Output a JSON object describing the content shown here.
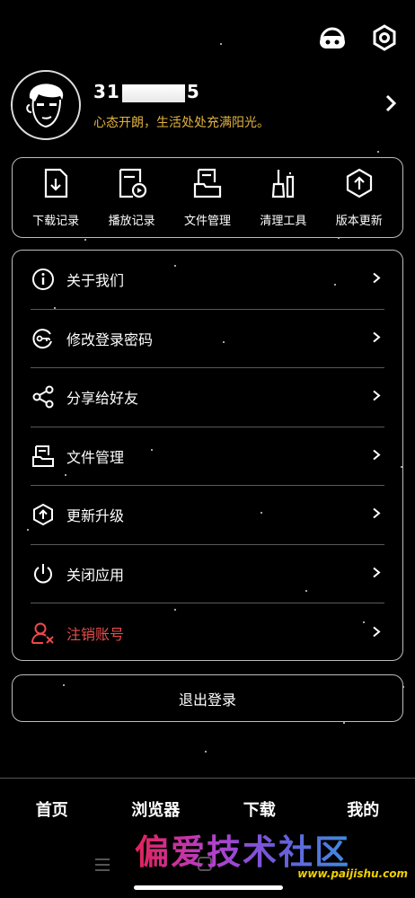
{
  "header": {
    "icons": [
      "support-icon",
      "settings-icon"
    ]
  },
  "profile": {
    "username_prefix": "31",
    "username_suffix": "5",
    "motto": "心态开朗，生活处处充满阳光。"
  },
  "quick_actions": [
    {
      "label": "下载记录",
      "icon": "download-file-icon"
    },
    {
      "label": "播放记录",
      "icon": "play-history-icon"
    },
    {
      "label": "文件管理",
      "icon": "file-manager-icon"
    },
    {
      "label": "清理工具",
      "icon": "broom-icon"
    },
    {
      "label": "版本更新",
      "icon": "update-icon"
    }
  ],
  "menu": [
    {
      "label": "关于我们",
      "icon": "info-icon"
    },
    {
      "label": "修改登录密码",
      "icon": "key-icon"
    },
    {
      "label": "分享给好友",
      "icon": "share-icon"
    },
    {
      "label": "文件管理",
      "icon": "file-manager-icon"
    },
    {
      "label": "更新升级",
      "icon": "upgrade-icon"
    },
    {
      "label": "关闭应用",
      "icon": "power-icon"
    },
    {
      "label": "注销账号",
      "icon": "user-remove-icon",
      "color": "#e94b4b"
    }
  ],
  "logout_label": "退出登录",
  "bottom_nav": [
    "首页",
    "浏览器",
    "下载",
    "我的"
  ],
  "watermark": {
    "text": "偏爱技术社区",
    "url": "www.paijishu.com"
  },
  "colors": {
    "background": "#000000",
    "motto": "#e2b341",
    "danger": "#e94b4b",
    "border": "#bdbdbd"
  }
}
